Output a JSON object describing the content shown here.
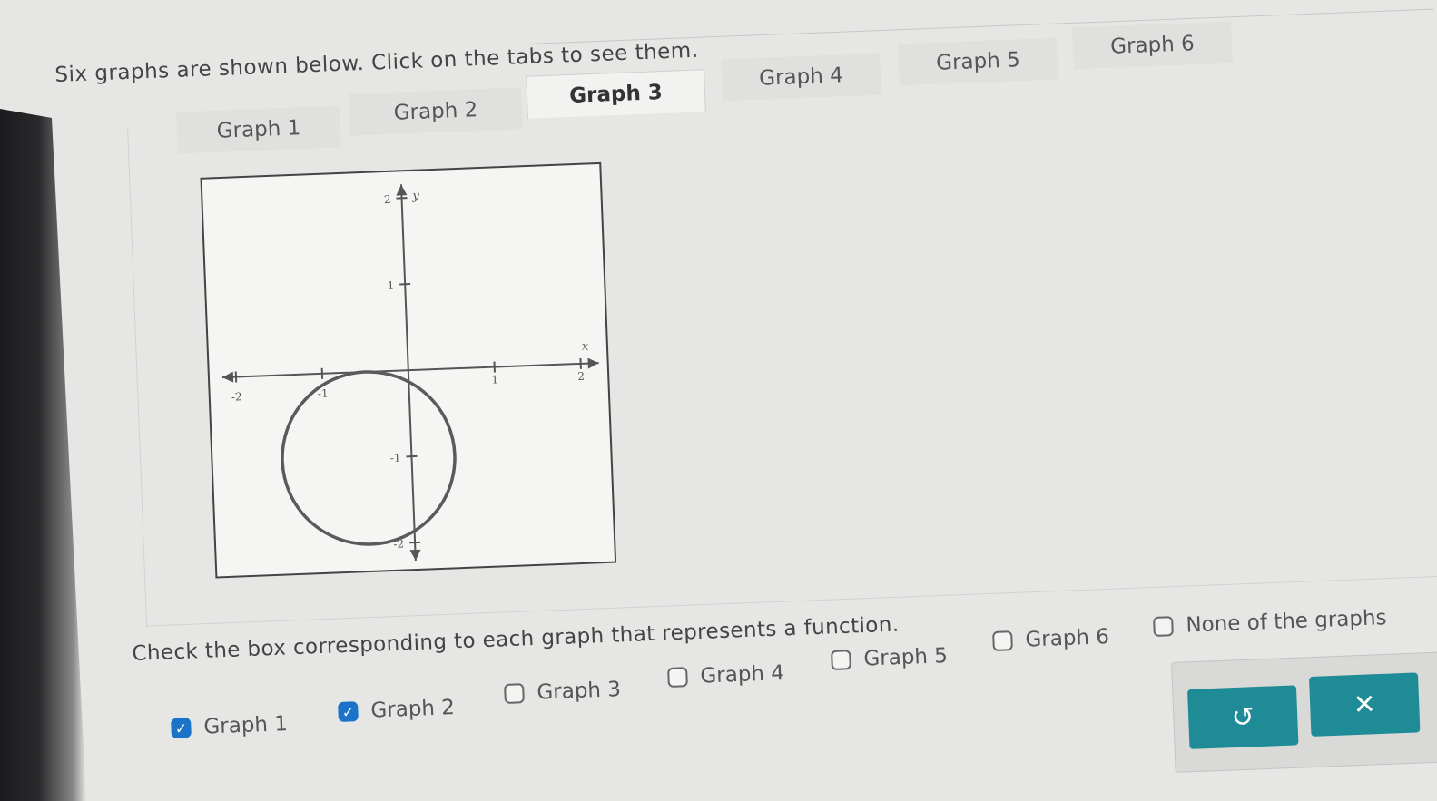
{
  "intro_text": "Six graphs are shown below. Click on the tabs to see them.",
  "tabs": [
    {
      "label": "Graph 1",
      "active": false
    },
    {
      "label": "Graph 2",
      "active": false
    },
    {
      "label": "Graph 3",
      "active": true
    },
    {
      "label": "Graph 4",
      "active": false
    },
    {
      "label": "Graph 5",
      "active": false
    },
    {
      "label": "Graph 6",
      "active": false
    }
  ],
  "graph": {
    "x_axis_label": "x",
    "y_axis_label": "y",
    "x_ticks": [
      "-2",
      "-1",
      "1",
      "2"
    ],
    "y_ticks": [
      "2",
      "1",
      "-1",
      "-2"
    ],
    "circle": {
      "center_x": -0.5,
      "center_y": -1,
      "radius": 1
    }
  },
  "question": "Check the box corresponding to each graph that represents a function.",
  "options": [
    {
      "label": "Graph 1",
      "checked": true
    },
    {
      "label": "Graph 2",
      "checked": true
    },
    {
      "label": "Graph 3",
      "checked": false
    },
    {
      "label": "Graph 4",
      "checked": false
    },
    {
      "label": "Graph 5",
      "checked": false
    },
    {
      "label": "Graph 6",
      "checked": false
    },
    {
      "label": "None of the graphs",
      "checked": false
    }
  ],
  "buttons": {
    "undo_icon": "undo-icon",
    "close_icon": "close-icon",
    "undo_symbol": "↺",
    "close_symbol": "✕"
  },
  "colors": {
    "accent": "#1f8b96",
    "checkbox_checked": "#1a73c8"
  }
}
